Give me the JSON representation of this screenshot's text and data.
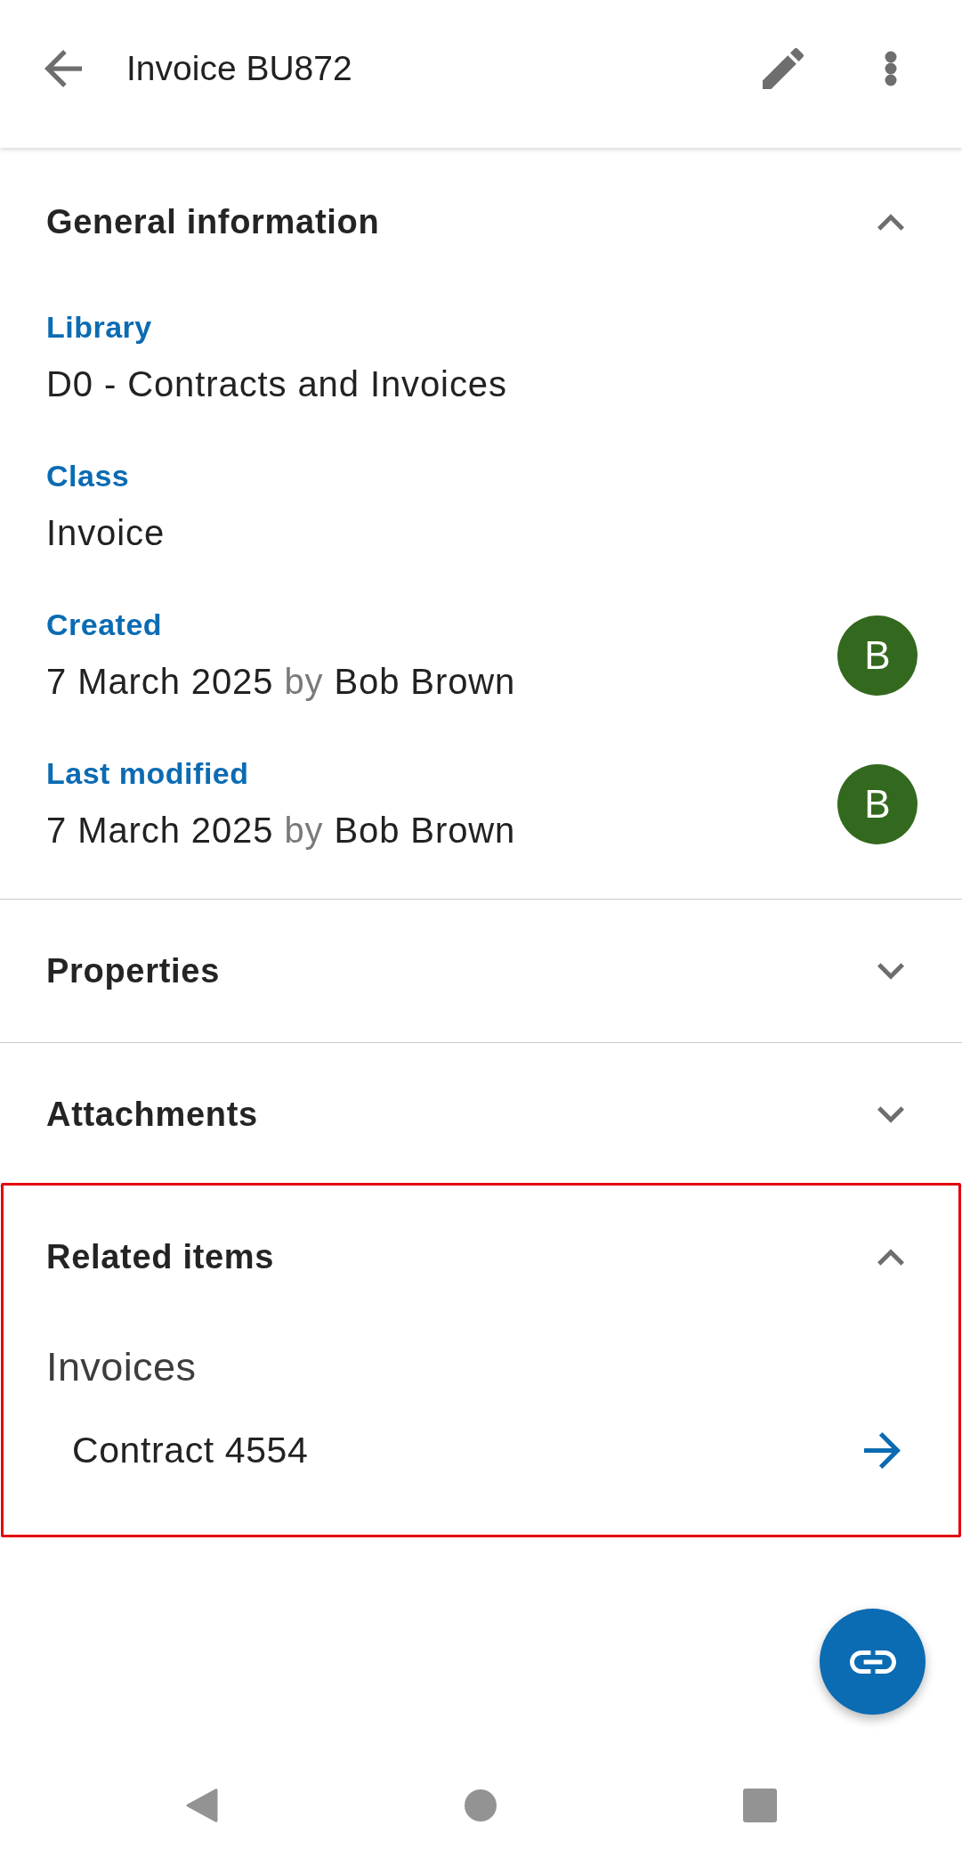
{
  "app_bar": {
    "title": "Invoice BU872"
  },
  "sections": [
    {
      "title": "General information",
      "expanded": true,
      "highlighted": false,
      "fields": [
        {
          "kind": "text",
          "label": "Library",
          "value": "D0 - Contracts and Invoices"
        },
        {
          "kind": "text",
          "label": "Class",
          "value": "Invoice"
        },
        {
          "kind": "user",
          "label": "Created",
          "date": "7 March 2025",
          "by": "by",
          "user": "Bob Brown",
          "avatar": "B"
        },
        {
          "kind": "user",
          "label": "Last modified",
          "date": "7 March 2025",
          "by": "by",
          "user": "Bob Brown",
          "avatar": "B"
        }
      ]
    },
    {
      "title": "Properties",
      "expanded": false,
      "highlighted": false
    },
    {
      "title": "Attachments",
      "expanded": false,
      "highlighted": false
    },
    {
      "title": "Related items",
      "expanded": true,
      "highlighted": true,
      "groups": [
        {
          "title": "Invoices",
          "items": [
            {
              "label": "Contract 4554"
            }
          ]
        }
      ]
    }
  ]
}
